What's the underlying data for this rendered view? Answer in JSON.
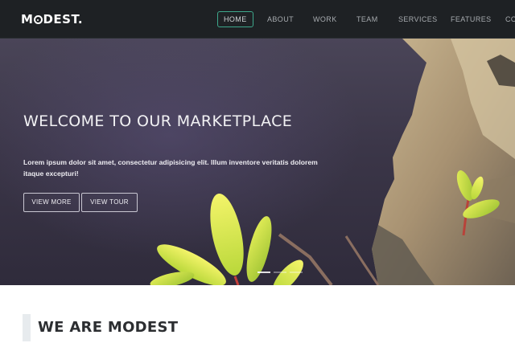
{
  "brand": {
    "logo_prefix": "M",
    "logo_suffix": "DEST."
  },
  "nav": {
    "items": [
      {
        "label": "HOME",
        "active": true
      },
      {
        "label": "ABOUT",
        "active": false
      },
      {
        "label": "WORK",
        "active": false
      },
      {
        "label": "TEAM",
        "active": false
      },
      {
        "label": "SERVICES",
        "active": false
      },
      {
        "label": "FEATURES",
        "active": false
      },
      {
        "label": "CO",
        "active": false
      }
    ]
  },
  "hero": {
    "title": "WELCOME TO OUR MARKETPLACE",
    "text": "Lorem ipsum dolor sit amet, consectetur adipisicing elit. Illum inventore veritatis dolorem itaque excepturi!",
    "primary_button": "VIEW MORE",
    "secondary_button": "VIEW TOUR",
    "slides": 3,
    "active_slide": 1
  },
  "section": {
    "title": "WE ARE MODEST"
  },
  "colors": {
    "navbar": "#1e2124",
    "accent": "#3ea88c",
    "hero_tint": "#3b3648"
  }
}
